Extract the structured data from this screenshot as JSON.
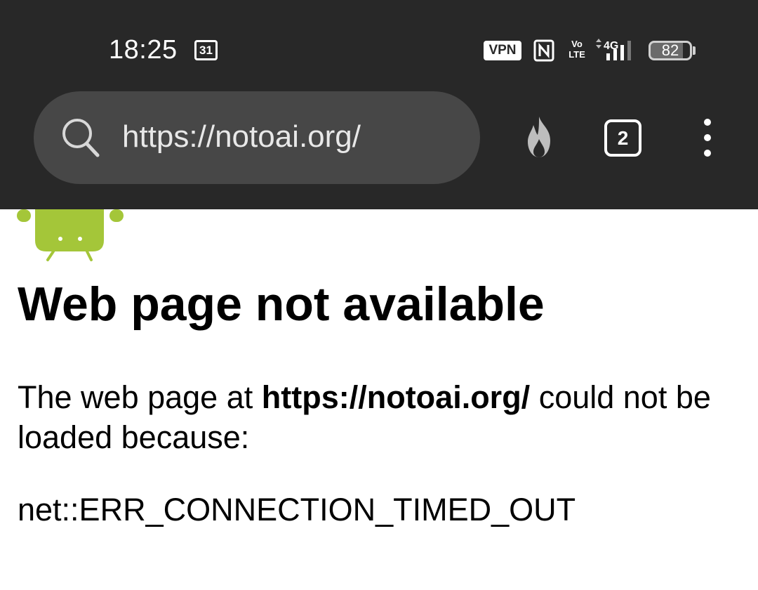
{
  "status_bar": {
    "time": "18:25",
    "calendar_day": "31",
    "vpn_label": "VPN",
    "volte_top": "Vo",
    "volte_bottom": "LTE",
    "network_label": "4G",
    "battery_level": "82"
  },
  "browser": {
    "url": "https://notoai.org/",
    "tab_count": "2"
  },
  "error_page": {
    "title": "Web page not available",
    "desc_prefix": "The web page at ",
    "desc_url": "https://notoai.org/",
    "desc_suffix": " could not be loaded because:",
    "error_code": "net::ERR_CONNECTION_TIMED_OUT"
  },
  "colors": {
    "toolbar_bg": "#282828",
    "url_bar_bg": "#474747",
    "android_green": "#a4c639"
  }
}
